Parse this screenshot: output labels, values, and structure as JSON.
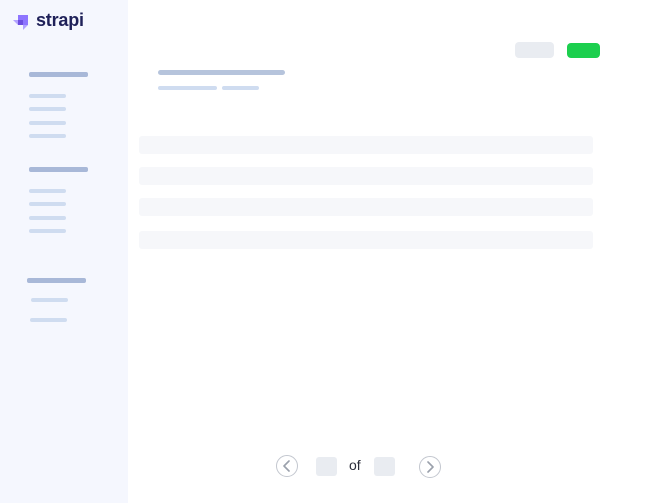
{
  "brand": {
    "name": "strapi",
    "logo_icon": "strapi-logo-icon",
    "accent": "#1ccf4e"
  },
  "pagination": {
    "of_label": "of",
    "prev_icon": "chevron-left-icon",
    "next_icon": "chevron-right-icon"
  }
}
